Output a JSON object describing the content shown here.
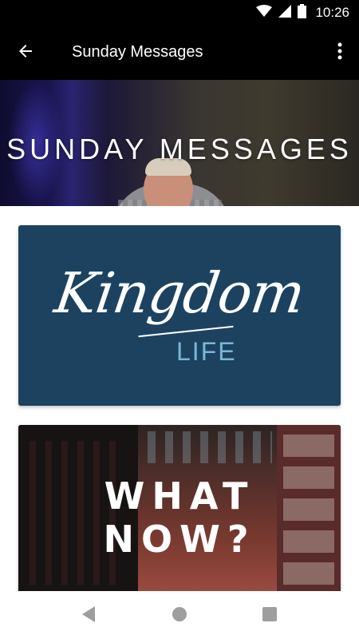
{
  "status_bar": {
    "time": "10:26",
    "icons": [
      "wifi-icon",
      "signal-icon",
      "battery-icon"
    ]
  },
  "app_bar": {
    "title": "Sunday Messages",
    "back_icon": "arrow-left-icon",
    "menu_icon": "more-vert-icon"
  },
  "hero": {
    "title": "SUNDAY MESSAGES"
  },
  "series": [
    {
      "title": "Kingdom",
      "subtitle": "LIFE",
      "background": "#1c4260",
      "accent": "#7ab6d6"
    },
    {
      "title_line1": "WHAT",
      "title_line2": "NOW?"
    }
  ],
  "nav_bar": {
    "icons": [
      "nav-back-icon",
      "nav-home-icon",
      "nav-recent-icon"
    ]
  },
  "colors": {
    "app_bar": "#000000",
    "background": "#ffffff",
    "nav_icon": "#9e9e9e"
  }
}
